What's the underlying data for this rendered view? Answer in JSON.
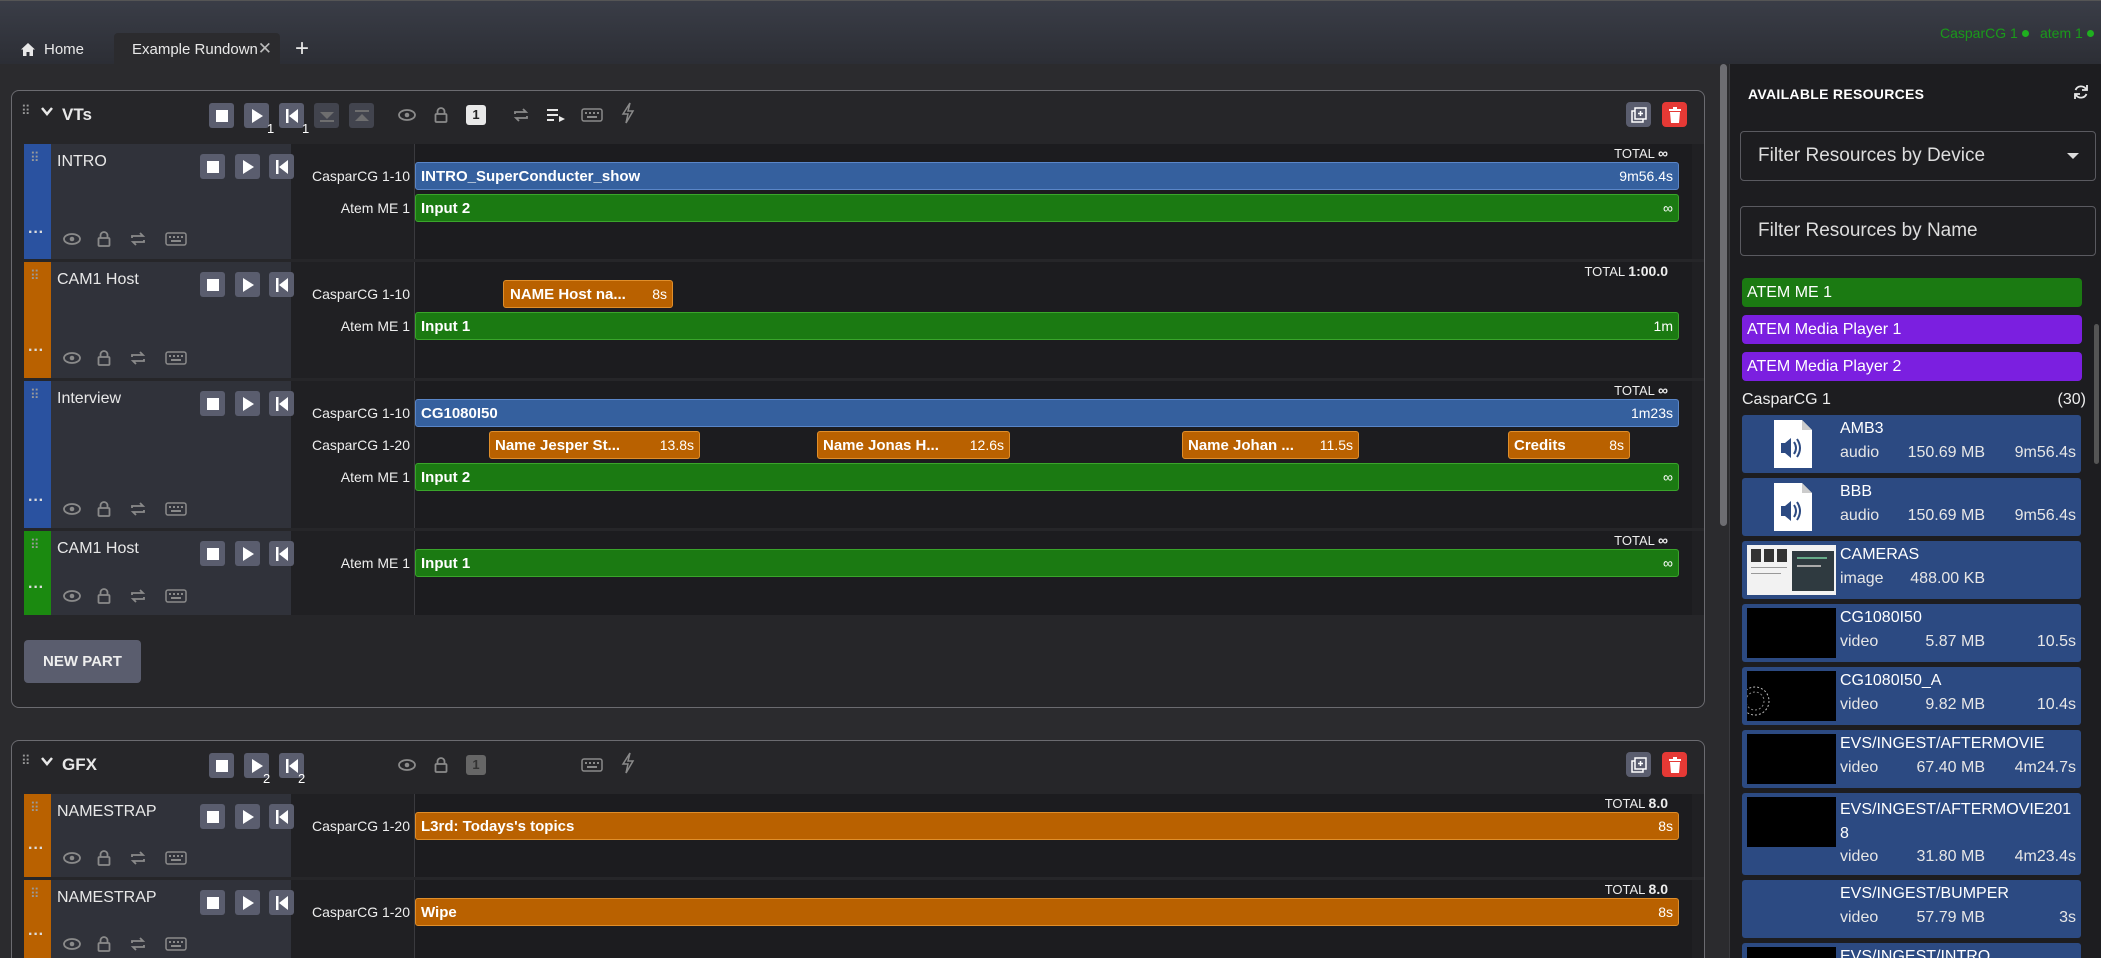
{
  "devices_status": [
    {
      "name": "CasparCG 1",
      "color": "#1fb01f"
    },
    {
      "name": "atem 1",
      "color": "#1fb01f"
    }
  ],
  "tabs": {
    "home": "Home",
    "rundown": "Example Rundown",
    "add": "+"
  },
  "groups": [
    {
      "title": "VTs",
      "play_count": "1",
      "restart_count": "1",
      "badge": "1",
      "parts": [
        {
          "name": "INTRO",
          "color": "#2a52a0",
          "total_label": "TOTAL",
          "total": "∞",
          "rows": [
            {
              "label": "CasparCG 1-10",
              "clips": [
                {
                  "name": "INTRO_SuperConducter_show",
                  "dur": "9m56.4s"
                }
              ]
            },
            {
              "label": "Atem ME 1",
              "clips": [
                {
                  "name": "Input 2",
                  "dur": "∞"
                }
              ]
            }
          ]
        },
        {
          "name": "CAM1 Host",
          "color": "#b96100",
          "total_label": "TOTAL",
          "total": "1:00.0",
          "rows": [
            {
              "label": "CasparCG 1-10",
              "clips": [
                {
                  "name": "NAME Host na...",
                  "dur": "8s"
                }
              ]
            },
            {
              "label": "Atem ME 1",
              "clips": [
                {
                  "name": "Input 1",
                  "dur": "1m"
                }
              ]
            }
          ]
        },
        {
          "name": "Interview",
          "color": "#2a52a0",
          "total_label": "TOTAL",
          "total": "∞",
          "rows": [
            {
              "label": "CasparCG 1-10",
              "clips": [
                {
                  "name": "CG1080I50",
                  "dur": "1m23s"
                }
              ]
            },
            {
              "label": "CasparCG 1-20",
              "clips": [
                {
                  "name": "Name Jesper St...",
                  "dur": "13.8s"
                },
                {
                  "name": "Name Jonas H...",
                  "dur": "12.6s"
                },
                {
                  "name": "Name Johan ...",
                  "dur": "11.5s"
                },
                {
                  "name": "Credits",
                  "dur": "8s"
                }
              ]
            },
            {
              "label": "Atem ME 1",
              "clips": [
                {
                  "name": "Input 2",
                  "dur": "∞"
                }
              ]
            }
          ]
        },
        {
          "name": "CAM1 Host",
          "color": "#1b8a10",
          "total_label": "TOTAL",
          "total": "∞",
          "rows": [
            {
              "label": "Atem ME 1",
              "clips": [
                {
                  "name": "Input 1",
                  "dur": "∞"
                }
              ]
            }
          ]
        }
      ],
      "new_part": "NEW PART"
    },
    {
      "title": "GFX",
      "play_count": "2",
      "restart_count": "2",
      "badge": "1",
      "parts": [
        {
          "name": "NAMESTRAP",
          "color": "#b96100",
          "total_label": "TOTAL",
          "total": "8.0",
          "rows": [
            {
              "label": "CasparCG 1-20",
              "clips": [
                {
                  "name": "L3rd: Todays's topics",
                  "dur": "8s"
                }
              ]
            }
          ]
        },
        {
          "name": "NAMESTRAP",
          "color": "#b96100",
          "total_label": "TOTAL",
          "total": "8.0",
          "rows": [
            {
              "label": "CasparCG 1-20",
              "clips": [
                {
                  "name": "Wipe",
                  "dur": "8s"
                }
              ]
            }
          ]
        }
      ]
    }
  ],
  "sidebar": {
    "title": "AVAILABLE RESOURCES",
    "filter_device_placeholder": "Filter Resources by Device",
    "filter_name_placeholder": "Filter Resources by Name",
    "devices": [
      {
        "name": "ATEM ME 1",
        "color": "#1b7a12"
      },
      {
        "name": "ATEM Media Player 1",
        "color": "#7b1fe0"
      },
      {
        "name": "ATEM Media Player 2",
        "color": "#7b1fe0"
      }
    ],
    "casparcg_header": "CasparCG 1",
    "casparcg_count": "(30)",
    "resources": [
      {
        "name": "AMB3",
        "type": "audio",
        "size": "150.69 MB",
        "dur": "9m56.4s",
        "thumb": "audio-file-icon"
      },
      {
        "name": "BBB",
        "type": "audio",
        "size": "150.69 MB",
        "dur": "9m56.4s",
        "thumb": "audio-file-icon"
      },
      {
        "name": "CAMERAS",
        "type": "image",
        "size": "488.00 KB",
        "dur": "",
        "thumb": "image-thumbnail"
      },
      {
        "name": "CG1080I50",
        "type": "video",
        "size": "5.87 MB",
        "dur": "10.5s",
        "thumb": "video-thumbnail"
      },
      {
        "name": "CG1080I50_A",
        "type": "video",
        "size": "9.82 MB",
        "dur": "10.4s",
        "thumb": "video-thumbnail"
      },
      {
        "name": "EVS/INGEST/AFTERMOVIE",
        "type": "video",
        "size": "67.40 MB",
        "dur": "4m24.7s",
        "thumb": "video-thumbnail"
      },
      {
        "name": "EVS/INGEST/AFTERMOVIE2018",
        "type": "video",
        "size": "31.80 MB",
        "dur": "4m23.4s",
        "thumb": "video-thumbnail"
      },
      {
        "name": "EVS/INGEST/BUMPER",
        "type": "video",
        "size": "57.79 MB",
        "dur": "3s",
        "thumb": "none"
      },
      {
        "name": "EVS/INGEST/INTRO",
        "type": "video",
        "size": "",
        "dur": "",
        "thumb": "video-thumbnail"
      }
    ]
  }
}
